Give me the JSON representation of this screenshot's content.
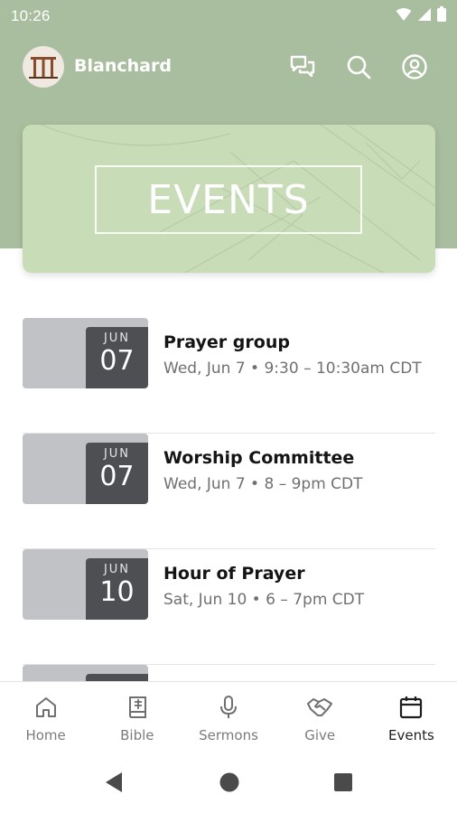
{
  "status_bar": {
    "time": "10:26"
  },
  "app_bar": {
    "org_name": "Blanchard"
  },
  "banner": {
    "title": "EVENTS"
  },
  "events": [
    {
      "month": "JUN",
      "day": "07",
      "title": "Prayer group",
      "meta": "Wed, Jun 7 • 9:30 – 10:30am CDT"
    },
    {
      "month": "JUN",
      "day": "07",
      "title": "Worship Committee",
      "meta": "Wed, Jun 7 • 8 – 9pm CDT"
    },
    {
      "month": "JUN",
      "day": "10",
      "title": "Hour of Prayer",
      "meta": "Sat, Jun 10 • 6 – 7pm CDT"
    },
    {
      "month": "",
      "day": "",
      "title": "",
      "meta": ""
    }
  ],
  "bottom_nav": {
    "items": [
      {
        "label": "Home",
        "icon": "home-icon"
      },
      {
        "label": "Bible",
        "icon": "bible-icon"
      },
      {
        "label": "Sermons",
        "icon": "microphone-icon"
      },
      {
        "label": "Give",
        "icon": "handshake-icon"
      },
      {
        "label": "Events",
        "icon": "calendar-icon"
      }
    ],
    "active": "Events"
  },
  "colors": {
    "header": "#a9bd9f",
    "banner": "#c8dcb8",
    "badge": "#4e4f52",
    "thumb": "#c1c2c6"
  }
}
